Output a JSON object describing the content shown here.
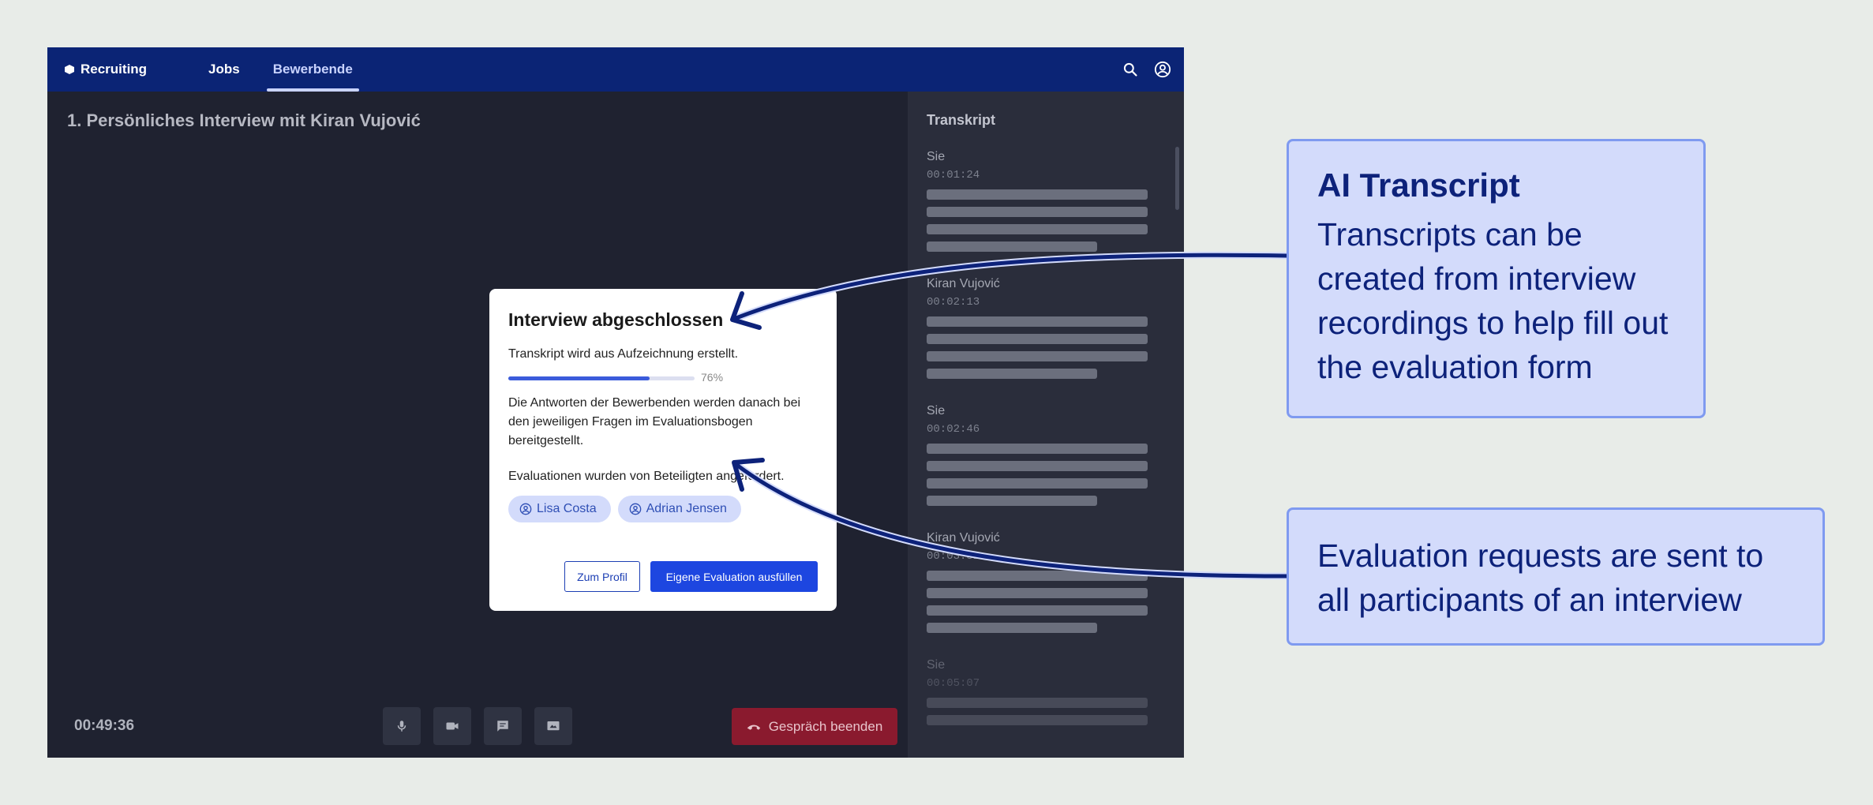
{
  "app": {
    "brand": "Recruiting",
    "nav": [
      {
        "label": "Jobs",
        "active": false
      },
      {
        "label": "Bewerbende",
        "active": true
      }
    ],
    "icons": {
      "search": "search-icon",
      "account": "account-circle-icon"
    }
  },
  "stage": {
    "title": "1. Persönliches Interview mit Kiran Vujović",
    "timer": "00:49:36",
    "controls": [
      "microphone-icon",
      "camera-icon",
      "chat-icon",
      "screen-share-icon"
    ],
    "end_call_label": "Gespräch beenden",
    "end_call_color": "#8a1a2e"
  },
  "transcript": {
    "title": "Transkript",
    "entries": [
      {
        "speaker": "Sie",
        "time": "00:01:24"
      },
      {
        "speaker": "Kiran Vujović",
        "time": "00:02:13"
      },
      {
        "speaker": "Sie",
        "time": "00:02:46"
      },
      {
        "speaker": "Kiran Vujović",
        "time": "00:03:51"
      },
      {
        "speaker": "Sie",
        "time": "00:05:07"
      }
    ]
  },
  "modal": {
    "title": "Interview abgeschlossen",
    "status": "Transkript wird aus Aufzeichnung erstellt.",
    "progress_percent": 76,
    "progress_label": "76%",
    "info": "Die Antworten der Bewerbenden werden danach bei den jeweiligen Fragen im Evaluationsbogen bereitgestellt.",
    "requested": "Evaluationen wurden von Beteiligten angefordert.",
    "participants": [
      "Lisa Costa",
      "Adrian Jensen"
    ],
    "secondary_button": "Zum Profil",
    "primary_button": "Eigene Evaluation ausfüllen",
    "accent_color": "#1d46e0"
  },
  "callouts": [
    {
      "heading": "AI Transcript",
      "text": "Transcripts can be created from interview recordings to help fill out the evaluation form"
    },
    {
      "text": "Evaluation requests are sent to all participants of an interview"
    }
  ]
}
